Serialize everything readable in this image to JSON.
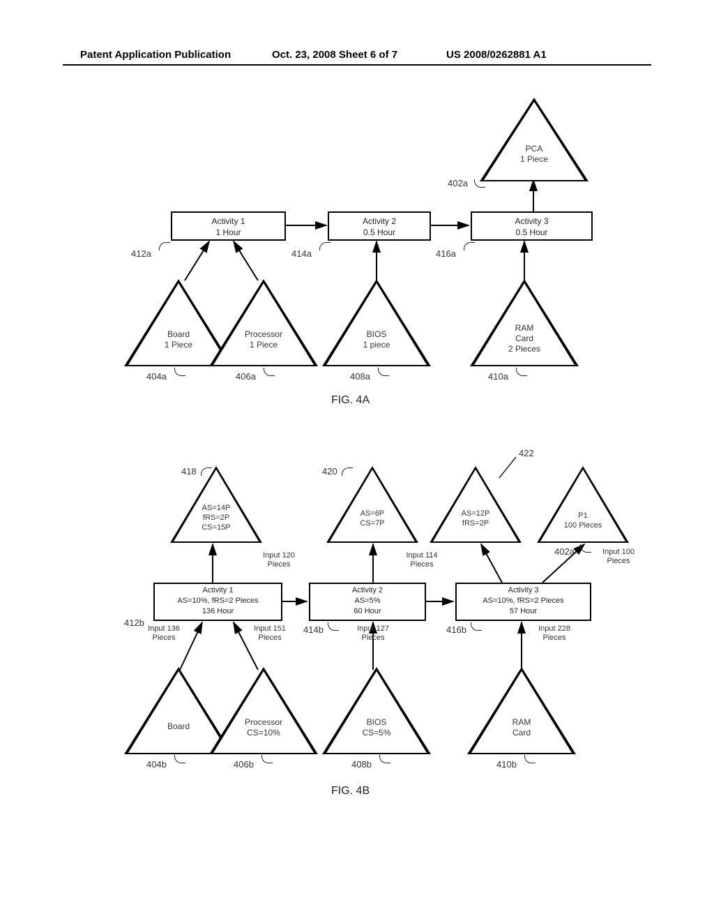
{
  "header": {
    "left": "Patent Application Publication",
    "center": "Oct. 23, 2008  Sheet 6 of 7",
    "right": "US 2008/0262881 A1"
  },
  "figA": {
    "caption": "FIG. 4A",
    "pca": {
      "line1": "PCA",
      "line2": "1 Piece",
      "ref": "402a"
    },
    "act1": {
      "line1": "Activity 1",
      "line2": "1 Hour",
      "ref": "412a"
    },
    "act2": {
      "line1": "Activity 2",
      "line2": "0.5 Hour",
      "ref": "414a"
    },
    "act3": {
      "line1": "Activity 3",
      "line2": "0.5 Hour",
      "ref": "416a"
    },
    "board": {
      "line1": "Board",
      "line2": "1 Piece",
      "ref": "404a"
    },
    "proc": {
      "line1": "Processor",
      "line2": "1 Piece",
      "ref": "406a"
    },
    "bios": {
      "line1": "BIOS",
      "line2": "1 piece",
      "ref": "408a"
    },
    "ram": {
      "line1": "RAM",
      "line2": "Card",
      "line3": "2 Pieces",
      "ref": "410a"
    }
  },
  "figB": {
    "caption": "FIG. 4B",
    "ref418": "418",
    "tri418": {
      "line1": "AS=14P",
      "line2": "fRS=2P",
      "line3": "CS=15P"
    },
    "ref420": "420",
    "tri420": {
      "line1": "AS=6P",
      "line2": "CS=7P"
    },
    "ref422": "422",
    "tri422": {
      "line1": "AS=12P",
      "line2": "fRS=2P"
    },
    "p1": {
      "line1": "P1",
      "line2": "100 Pieces",
      "ref": "402a"
    },
    "act1": {
      "line1": "Activity 1",
      "line2": "AS=10%, fRS=2 Pieces",
      "line3": "136 Hour",
      "ref": "412b"
    },
    "act2": {
      "line1": "Activity 2",
      "line2": "AS=5%",
      "line3": "60 Hour",
      "ref": "414b"
    },
    "act3": {
      "line1": "Activity 3",
      "line2": "AS=10%, fRS=2 Pieces",
      "line3": "57 Hour",
      "ref": "416b"
    },
    "board": {
      "line1": "Board",
      "ref": "404b"
    },
    "proc": {
      "line1": "Processor",
      "line2": "CS=10%",
      "ref": "406b"
    },
    "bios": {
      "line1": "BIOS",
      "line2": "CS=5%",
      "ref": "408b"
    },
    "ram": {
      "line1": "RAM",
      "line2": "Card",
      "ref": "410b"
    },
    "edges": {
      "in120": "Input 120\nPieces",
      "in114": "Input 114\nPieces",
      "in100": "Input 100\nPieces",
      "in136": "Input 136\nPieces",
      "in151": "Input 151\nPieces",
      "in127": "Input 127\nPieces",
      "in228": "Input 228\nPieces"
    }
  }
}
